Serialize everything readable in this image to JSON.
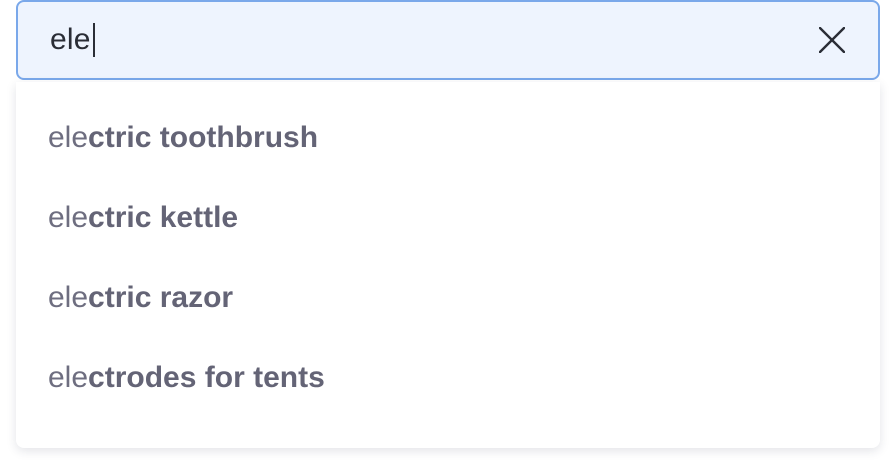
{
  "search": {
    "value": "ele",
    "clear_icon": "close-icon"
  },
  "suggestions": [
    {
      "match": "ele",
      "rest": "ctric toothbrush"
    },
    {
      "match": "ele",
      "rest": "ctric kettle"
    },
    {
      "match": "ele",
      "rest": "ctric razor"
    },
    {
      "match": "ele",
      "rest": "ctrodes for tents"
    }
  ],
  "colors": {
    "input_border": "#7aa8ea",
    "input_background": "#eef4fe",
    "suggestion_text": "#646476"
  }
}
